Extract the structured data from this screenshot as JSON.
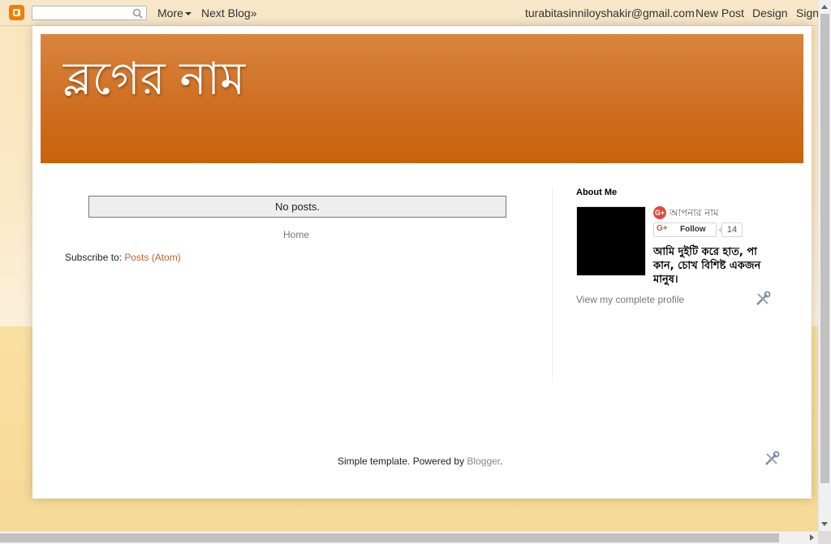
{
  "navbar": {
    "search_placeholder": "",
    "more_label": "More",
    "next_blog_label": "Next Blog»",
    "email": "turabitasinniloyshakir@gmail.com",
    "new_post_label": "New Post",
    "design_label": "Design",
    "sign_out_label": "Sign"
  },
  "header": {
    "blog_title": "ব্লগের নাম"
  },
  "main": {
    "no_posts": "No posts.",
    "home_link": "Home",
    "subscribe_prefix": "Subscribe to: ",
    "subscribe_link": "Posts (Atom)"
  },
  "sidebar": {
    "about_title": "About Me",
    "profile_name": "আপনার নাম",
    "follow_label": "Follow",
    "follow_count": "14",
    "about_text": "আমি দুইটি করে হাত, পা কান, চোখ বিশিষ্ট একজন মানুষ।",
    "view_profile": "View my complete profile"
  },
  "footer": {
    "prefix": "Simple template. Powered by ",
    "blogger_link": "Blogger",
    "suffix": "."
  },
  "colors": {
    "header_gradient_top": "#d8843f",
    "header_gradient_bottom": "#c9620a",
    "link_color": "#c5622a",
    "background": "#f6d99b"
  }
}
